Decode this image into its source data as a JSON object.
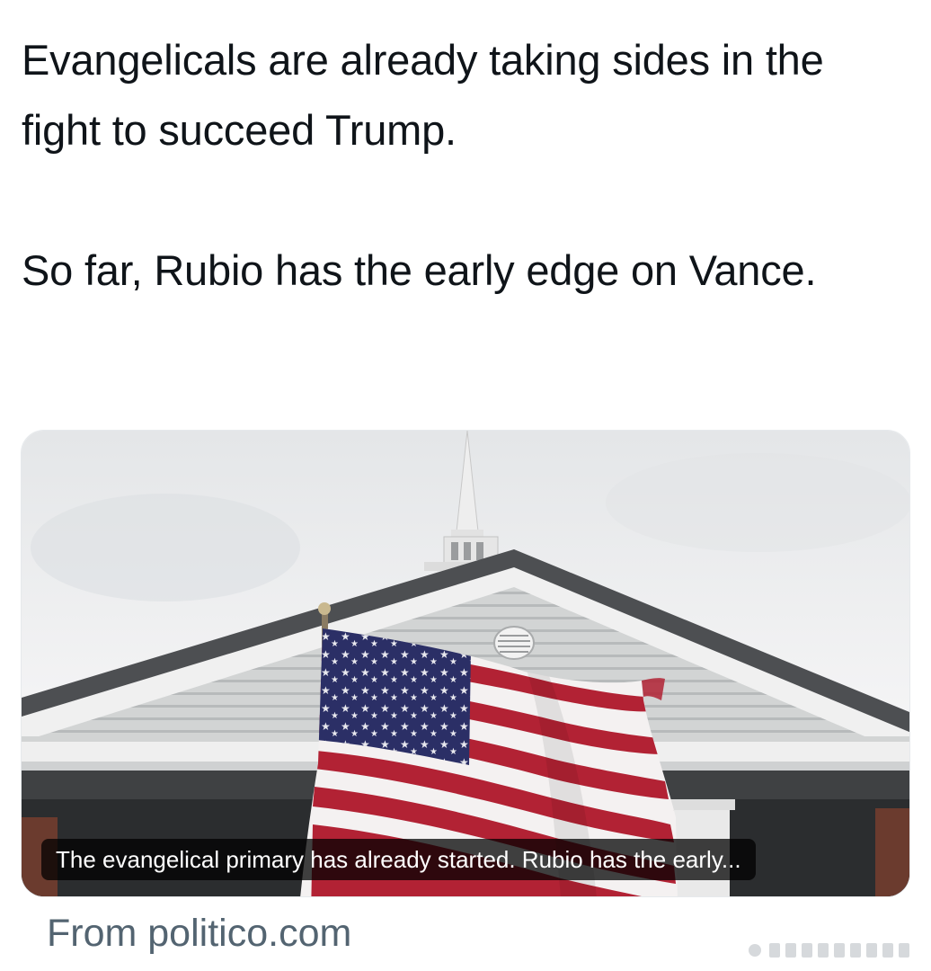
{
  "tweet": {
    "paragraph_1": "Evangelicals are already taking sides in the fight to succeed Trump.",
    "paragraph_2": "So far, Rubio has the early edge on Vance."
  },
  "link_card": {
    "caption": "The evangelical primary has already started. Rubio has the early...",
    "source": "From politico.com"
  },
  "colors": {
    "text": "#0f1419",
    "secondary_text": "#536471",
    "flag_red": "#b22234",
    "flag_blue": "#2b2f66"
  }
}
